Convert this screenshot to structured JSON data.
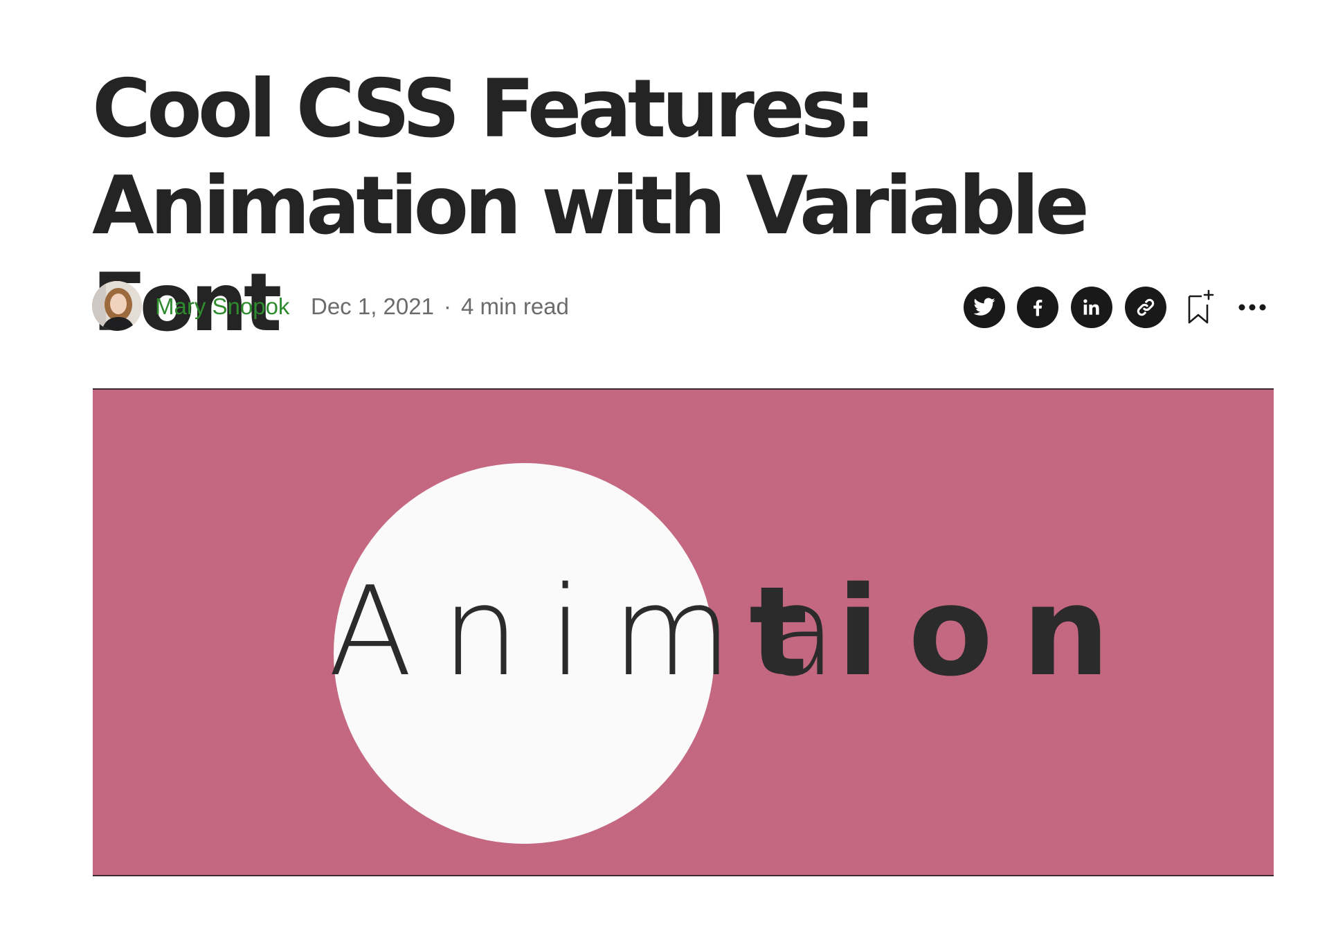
{
  "article": {
    "title": "Cool CSS Features: Animation with Variable Font"
  },
  "byline": {
    "author": "Mary Snopok",
    "date": "Dec 1, 2021",
    "separator": "·",
    "read_time": "4 min read"
  },
  "actions": [
    {
      "name": "twitter-share-button",
      "icon": "twitter-icon"
    },
    {
      "name": "facebook-share-button",
      "icon": "facebook-icon"
    },
    {
      "name": "linkedin-share-button",
      "icon": "linkedin-icon"
    },
    {
      "name": "copy-link-button",
      "icon": "link-icon"
    },
    {
      "name": "bookmark-button",
      "icon": "bookmark-add-icon"
    },
    {
      "name": "more-options-button",
      "icon": "more-horizontal-icon"
    }
  ],
  "hero": {
    "light_text": "Anima",
    "bold_text": "tion",
    "colors": {
      "background": "#c46882",
      "circle": "#fafafa",
      "text": "#2b2b2b"
    }
  },
  "colors": {
    "title": "#242424",
    "author": "#2e8b2e",
    "meta": "#6b6b6b",
    "icon": "#191919"
  }
}
